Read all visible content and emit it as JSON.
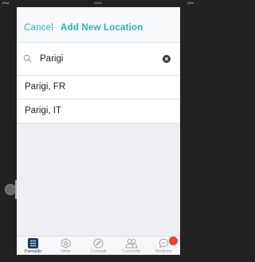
{
  "status_bar": {
    "carrier": "iPad",
    "time": "13:01",
    "battery": "23%"
  },
  "nav": {
    "cancel_label": "Cancel",
    "title": "Add New Location"
  },
  "search": {
    "value": "Parigi",
    "placeholder": ""
  },
  "results": [
    {
      "label": "Parigi, FR"
    },
    {
      "label": "Parigi, IT"
    }
  ],
  "tabs": [
    {
      "label": "Pannello",
      "icon": "dashboard-grid-icon",
      "active": true
    },
    {
      "label": "Sfide",
      "icon": "star-badge-icon",
      "active": false
    },
    {
      "label": "Consigli",
      "icon": "compass-icon",
      "active": false
    },
    {
      "label": "Comunità",
      "icon": "people-icon",
      "active": false
    },
    {
      "label": "Notifiche",
      "icon": "chat-bubble-icon",
      "active": false,
      "badge": true
    }
  ],
  "colors": {
    "accent": "#2fb0b5",
    "badge": "#e8423c",
    "active_tab": "#1d3a5f"
  }
}
